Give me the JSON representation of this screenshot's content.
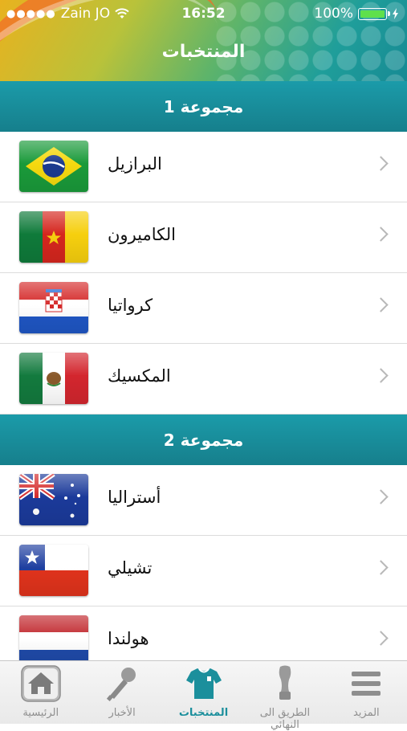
{
  "status_bar": {
    "carrier": "Zain JO",
    "time": "16:52",
    "battery": "100%"
  },
  "header": {
    "title": "المنتخبات"
  },
  "groups": [
    {
      "title": "مجموعة 1",
      "teams": [
        {
          "name": "البرازيل",
          "flag": "brazil-flag-icon"
        },
        {
          "name": "الكاميرون",
          "flag": "cameroon-flag-icon"
        },
        {
          "name": "كرواتيا",
          "flag": "croatia-flag-icon"
        },
        {
          "name": "المكسيك",
          "flag": "mexico-flag-icon"
        }
      ]
    },
    {
      "title": "مجموعة 2",
      "teams": [
        {
          "name": "أستراليا",
          "flag": "australia-flag-icon"
        },
        {
          "name": "تشيلي",
          "flag": "chile-flag-icon"
        },
        {
          "name": "هولندا",
          "flag": "netherlands-flag-icon"
        }
      ]
    }
  ],
  "tabbar": {
    "home": "الرئيسية",
    "news": "الأخبار",
    "teams": "المنتخبات",
    "road_to_final": "الطريق الى النهائي",
    "more": "المزيد"
  },
  "colors": {
    "accent": "#1b9ba9",
    "active_tab": "#1b8f9c",
    "inactive_tab": "#8e8e8e"
  }
}
